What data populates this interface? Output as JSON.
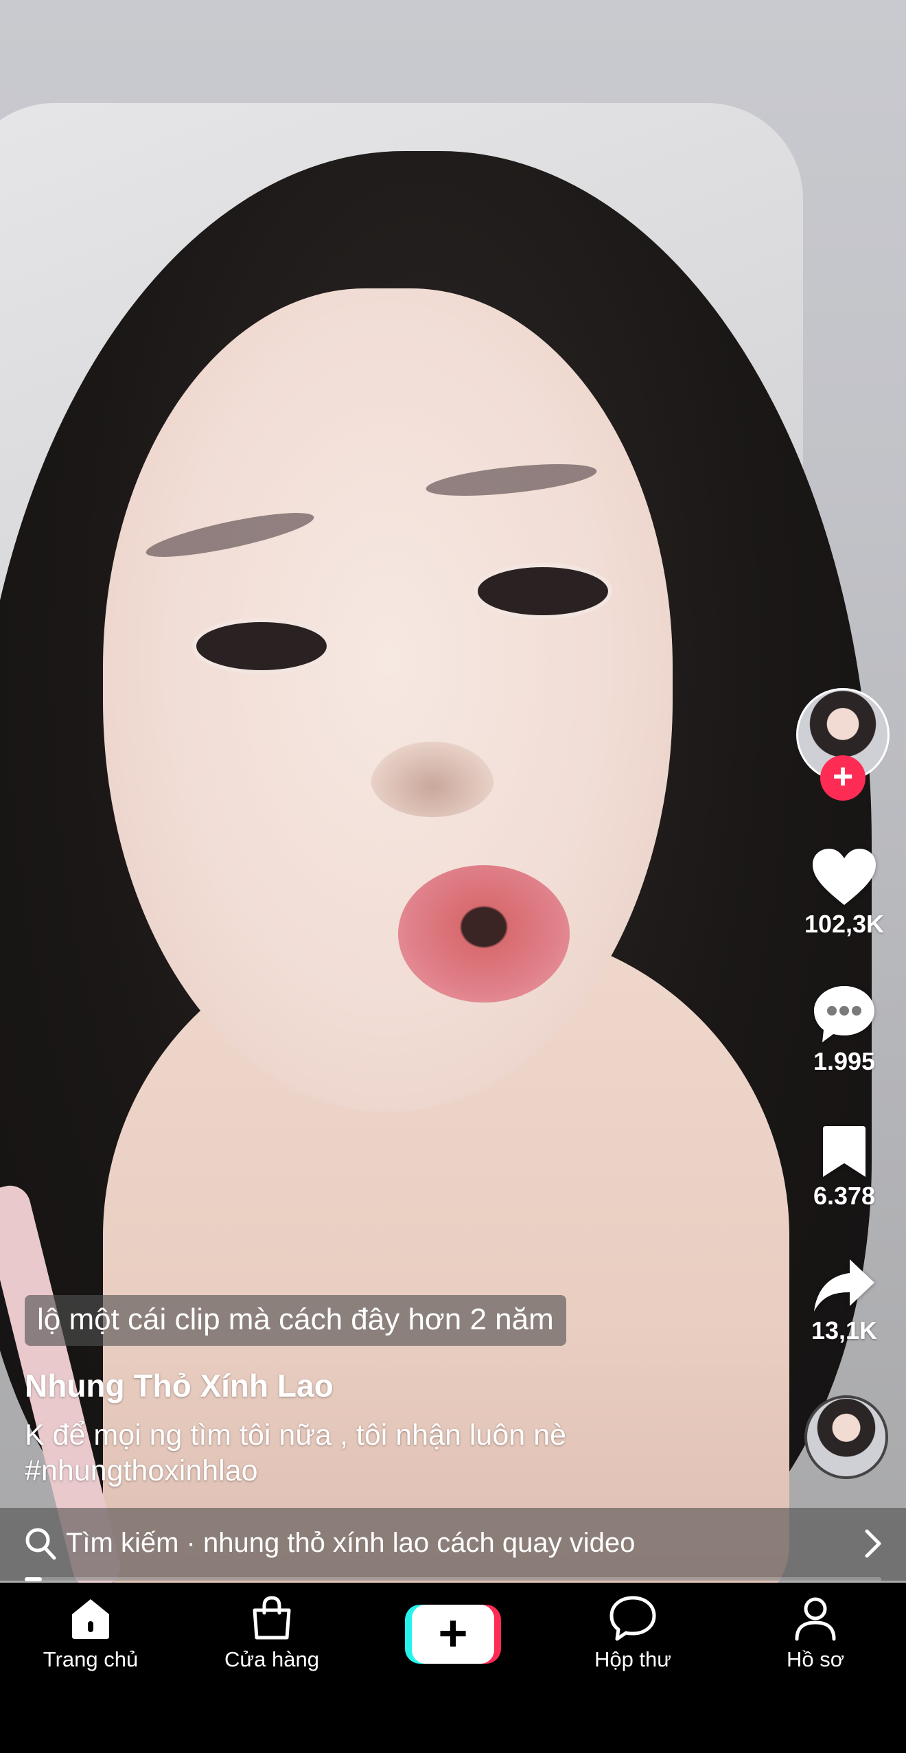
{
  "video": {
    "caption_overlay": "lộ một cái clip mà cách đây hơn 2 năm",
    "author_name": "Nhung Thỏ Xính Lao",
    "description_line1": "K để mọi ng tìm tôi nữa , tôi nhận luôn nè",
    "hashtag": "#nhungthoxinhlao",
    "progress_fraction": 0.02
  },
  "actions": {
    "follow_symbol": "+",
    "likes": "102,3K",
    "comments": "1.995",
    "saves": "6.378",
    "shares": "13,1K",
    "icons": [
      "heart-icon",
      "comment-icon",
      "bookmark-icon",
      "share-icon"
    ]
  },
  "search": {
    "text": "Tìm kiếm · nhung thỏ xính lao cách quay video"
  },
  "nav": {
    "home": "Trang chủ",
    "shop": "Cửa hàng",
    "create_symbol": "+",
    "inbox": "Hộp thư",
    "profile": "Hồ sơ"
  },
  "colors": {
    "accent_red": "#fe2c55",
    "accent_cyan": "#25f4ee",
    "nav_bg": "#000000"
  }
}
